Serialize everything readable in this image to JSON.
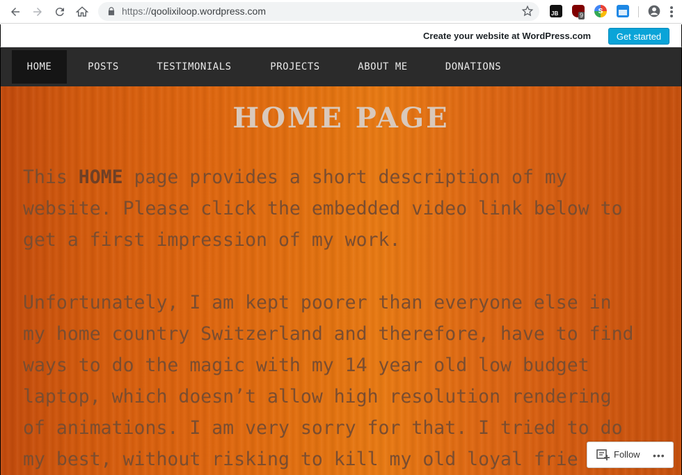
{
  "browser": {
    "url_scheme": "https://",
    "url_host": "qoolixiloop.wordpress.com",
    "ublock_badge": "9",
    "ext_jb_label": "JB",
    "ext_s_label": "S"
  },
  "wp_banner": {
    "text": "Create your website at WordPress.com",
    "button": "Get started"
  },
  "menu": {
    "items": [
      {
        "label": "HOME",
        "active": true
      },
      {
        "label": "POSTS"
      },
      {
        "label": "TESTIMONIALS"
      },
      {
        "label": "PROJECTS"
      },
      {
        "label": "ABOUT ME"
      },
      {
        "label": "DONATIONS"
      }
    ]
  },
  "page": {
    "title": "HOME PAGE",
    "para1": {
      "line1_pre": "This ",
      "line1_bold": "HOME",
      "line1_post": " page provides a short description of my",
      "line2": "website. Please click the embedded video link below to",
      "line3": "get a first impression of my work."
    },
    "para2": {
      "lines": [
        "Unfortunately, I am kept poorer than everyone else in",
        "my home country Switzerland and therefore, have to find",
        "ways to do the magic with my 14 year old low budget",
        "laptop, which doesn’t allow high resolution rendering",
        "of animations. I am very sorry for that. I tried to do",
        "my best, without risking to kill my old loyal frie"
      ]
    }
  },
  "follow": {
    "label": "Follow",
    "more": "•••"
  }
}
